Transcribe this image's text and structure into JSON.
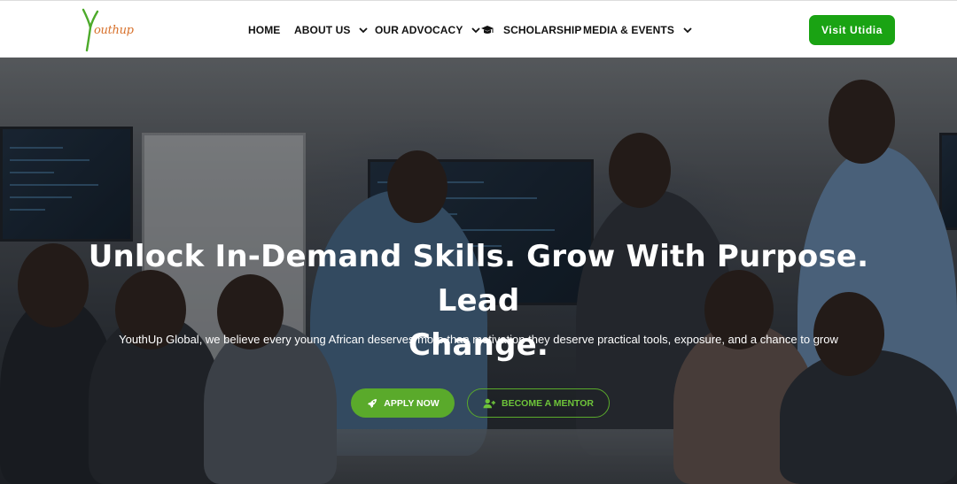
{
  "brand": {
    "logo_text": "outhup",
    "logo_letter": "Y"
  },
  "nav": {
    "home": "HOME",
    "about": "ABOUT US",
    "advocacy": "OUR ADVOCACY",
    "scholarship": "SCHOLARSHIP",
    "media": "MEDIA & EVENTS"
  },
  "cta": {
    "visit": "Visit Utidia"
  },
  "hero": {
    "headline_line1": "Unlock In-Demand Skills. Grow With Purpose. Lead",
    "headline_line2": "Change.",
    "subtitle": "YouthUp Global, we believe every young African deserves more than motivation they deserve practical tools, exposure, and a chance to grow",
    "apply_label": "APPLY NOW",
    "mentor_label": "BECOME A MENTOR"
  },
  "colors": {
    "brand_green": "#1aa313",
    "accent_green": "#5aaa2b",
    "logo_orange": "#d7702a"
  },
  "icons": {
    "chevron": "chevron-down-icon",
    "scholarship": "graduation-cap-icon",
    "apply": "rocket-icon",
    "mentor": "user-plus-icon"
  }
}
